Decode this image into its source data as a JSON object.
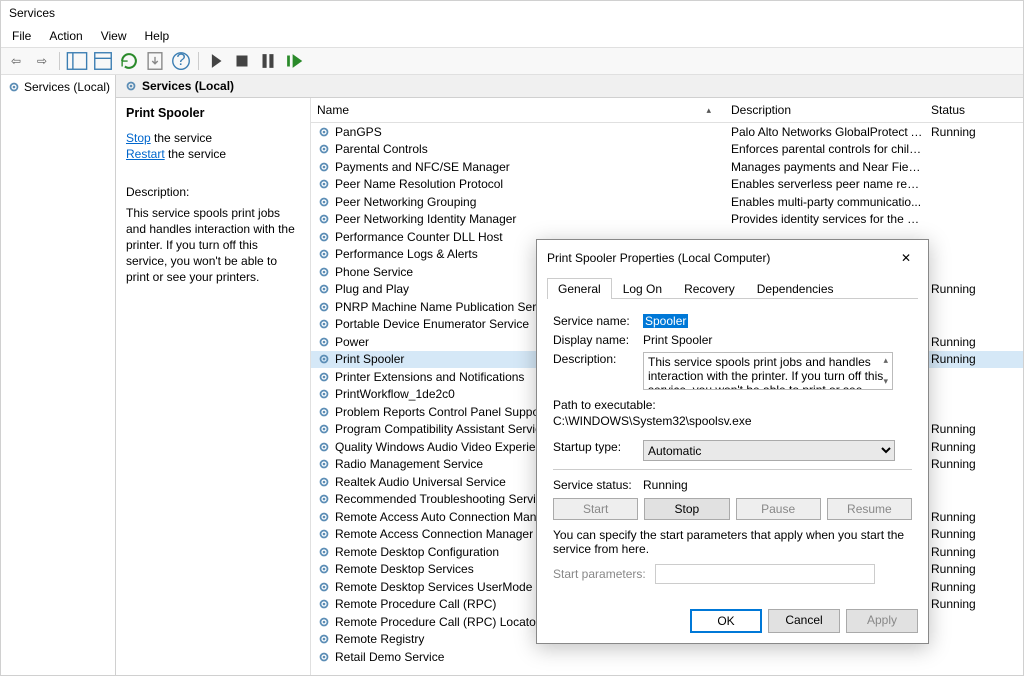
{
  "window": {
    "title": "Services"
  },
  "menu": [
    "File",
    "Action",
    "View",
    "Help"
  ],
  "toolbar_icons": [
    "back",
    "forward",
    "up",
    "props",
    "delete",
    "help",
    "export",
    "start",
    "stop",
    "pause",
    "restart"
  ],
  "tree": {
    "root": "Services (Local)"
  },
  "tab_header": "Services (Local)",
  "detail": {
    "title": "Print Spooler",
    "stop_label": "Stop",
    "restart_label": "Restart",
    "the_service": " the service",
    "desc_label": "Description:",
    "desc_text": "This service spools print jobs and handles interaction with the printer. If you turn off this service, you won't be able to print or see your printers."
  },
  "columns": {
    "name": "Name",
    "desc": "Description",
    "status": "Status"
  },
  "services": [
    {
      "name": "PanGPS",
      "desc": "Palo Alto Networks GlobalProtect A...",
      "status": "Running"
    },
    {
      "name": "Parental Controls",
      "desc": "Enforces parental controls for child ...",
      "status": ""
    },
    {
      "name": "Payments and NFC/SE Manager",
      "desc": "Manages payments and Near Field ...",
      "status": ""
    },
    {
      "name": "Peer Name Resolution Protocol",
      "desc": "Enables serverless peer name resolu...",
      "status": ""
    },
    {
      "name": "Peer Networking Grouping",
      "desc": "Enables multi-party communicatio...",
      "status": ""
    },
    {
      "name": "Peer Networking Identity Manager",
      "desc": "Provides identity services for the Pe...",
      "status": ""
    },
    {
      "name": "Performance Counter DLL Host",
      "desc": "",
      "status": ""
    },
    {
      "name": "Performance Logs & Alerts",
      "desc": "",
      "status": ""
    },
    {
      "name": "Phone Service",
      "desc": "",
      "status": ""
    },
    {
      "name": "Plug and Play",
      "desc": "",
      "status": "Running"
    },
    {
      "name": "PNRP Machine Name Publication Service",
      "desc": "",
      "status": ""
    },
    {
      "name": "Portable Device Enumerator Service",
      "desc": "",
      "status": ""
    },
    {
      "name": "Power",
      "desc": "",
      "status": "Running"
    },
    {
      "name": "Print Spooler",
      "desc": "",
      "status": "Running",
      "selected": true
    },
    {
      "name": "Printer Extensions and Notifications",
      "desc": "",
      "status": ""
    },
    {
      "name": "PrintWorkflow_1de2c0",
      "desc": "",
      "status": ""
    },
    {
      "name": "Problem Reports Control Panel Support",
      "desc": "",
      "status": ""
    },
    {
      "name": "Program Compatibility Assistant Service",
      "desc": "",
      "status": "Running"
    },
    {
      "name": "Quality Windows Audio Video Experience",
      "desc": "",
      "status": "Running"
    },
    {
      "name": "Radio Management Service",
      "desc": "",
      "status": "Running"
    },
    {
      "name": "Realtek Audio Universal Service",
      "desc": "",
      "status": ""
    },
    {
      "name": "Recommended Troubleshooting Service",
      "desc": "",
      "status": ""
    },
    {
      "name": "Remote Access Auto Connection Manag",
      "desc": "",
      "status": "Running"
    },
    {
      "name": "Remote Access Connection Manager",
      "desc": "",
      "status": "Running"
    },
    {
      "name": "Remote Desktop Configuration",
      "desc": "",
      "status": "Running"
    },
    {
      "name": "Remote Desktop Services",
      "desc": "",
      "status": "Running"
    },
    {
      "name": "Remote Desktop Services UserMode Port",
      "desc": "",
      "status": "Running"
    },
    {
      "name": "Remote Procedure Call (RPC)",
      "desc": "",
      "status": "Running"
    },
    {
      "name": "Remote Procedure Call (RPC) Locator",
      "desc": "",
      "status": ""
    },
    {
      "name": "Remote Registry",
      "desc": "",
      "status": ""
    },
    {
      "name": "Retail Demo Service",
      "desc": "",
      "status": ""
    }
  ],
  "dialog": {
    "title": "Print Spooler Properties (Local Computer)",
    "tabs": [
      "General",
      "Log On",
      "Recovery",
      "Dependencies"
    ],
    "svc_name_label": "Service name:",
    "svc_name": "Spooler",
    "disp_name_label": "Display name:",
    "disp_name": "Print Spooler",
    "desc_label": "Description:",
    "desc": "This service spools print jobs and handles interaction with the printer.  If you turn off this service, you won't be able to print or see your printers.",
    "path_label": "Path to executable:",
    "path": "C:\\WINDOWS\\System32\\spoolsv.exe",
    "startup_label": "Startup type:",
    "startup": "Automatic",
    "status_label": "Service status:",
    "status": "Running",
    "btn_start": "Start",
    "btn_stop": "Stop",
    "btn_pause": "Pause",
    "btn_resume": "Resume",
    "params_hint": "You can specify the start parameters that apply when you start the service from here.",
    "params_label": "Start parameters:",
    "ok": "OK",
    "cancel": "Cancel",
    "apply": "Apply"
  }
}
